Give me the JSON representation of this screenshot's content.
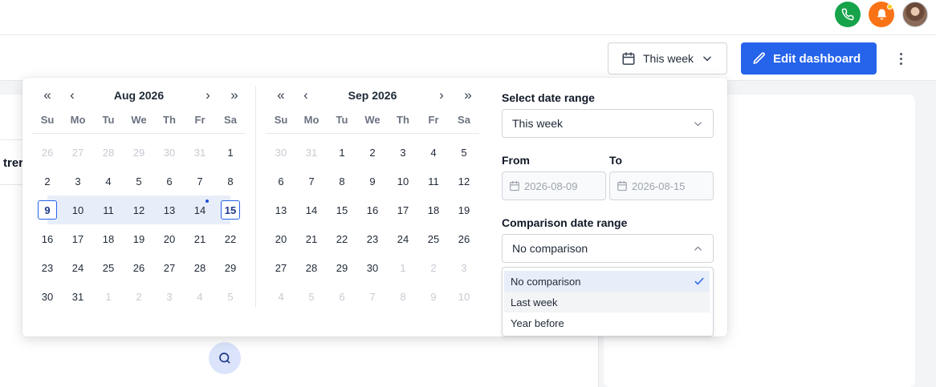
{
  "header": {
    "icons": [
      "phone-icon",
      "bell-icon",
      "avatar"
    ],
    "colors": {
      "phone": "#16a34a",
      "bell": "#f97316",
      "accent": "#2563eb"
    }
  },
  "toolbar": {
    "date_filter_label": "This week",
    "edit_label": "Edit dashboard"
  },
  "background": {
    "partial_heading": "trer"
  },
  "picker": {
    "months": [
      {
        "title": "Aug 2026",
        "weekdays": [
          "Su",
          "Mo",
          "Tu",
          "We",
          "Th",
          "Fr",
          "Sa"
        ],
        "days": [
          {
            "d": "26",
            "muted": true
          },
          {
            "d": "27",
            "muted": true
          },
          {
            "d": "28",
            "muted": true
          },
          {
            "d": "29",
            "muted": true
          },
          {
            "d": "30",
            "muted": true
          },
          {
            "d": "31",
            "muted": true
          },
          {
            "d": "1"
          },
          {
            "d": "2"
          },
          {
            "d": "3"
          },
          {
            "d": "4"
          },
          {
            "d": "5"
          },
          {
            "d": "6"
          },
          {
            "d": "7"
          },
          {
            "d": "8"
          },
          {
            "d": "9",
            "state": "start"
          },
          {
            "d": "10",
            "state": "range"
          },
          {
            "d": "11",
            "state": "range"
          },
          {
            "d": "12",
            "state": "range"
          },
          {
            "d": "13",
            "state": "range"
          },
          {
            "d": "14",
            "state": "range",
            "today": true
          },
          {
            "d": "15",
            "state": "end"
          },
          {
            "d": "16"
          },
          {
            "d": "17"
          },
          {
            "d": "18"
          },
          {
            "d": "19"
          },
          {
            "d": "20"
          },
          {
            "d": "21"
          },
          {
            "d": "22"
          },
          {
            "d": "23"
          },
          {
            "d": "24"
          },
          {
            "d": "25"
          },
          {
            "d": "26"
          },
          {
            "d": "27"
          },
          {
            "d": "28"
          },
          {
            "d": "29"
          },
          {
            "d": "30"
          },
          {
            "d": "31"
          },
          {
            "d": "1",
            "muted": true
          },
          {
            "d": "2",
            "muted": true
          },
          {
            "d": "3",
            "muted": true
          },
          {
            "d": "4",
            "muted": true
          },
          {
            "d": "5",
            "muted": true
          }
        ]
      },
      {
        "title": "Sep 2026",
        "weekdays": [
          "Su",
          "Mo",
          "Tu",
          "We",
          "Th",
          "Fr",
          "Sa"
        ],
        "days": [
          {
            "d": "30",
            "muted": true
          },
          {
            "d": "31",
            "muted": true
          },
          {
            "d": "1"
          },
          {
            "d": "2"
          },
          {
            "d": "3"
          },
          {
            "d": "4"
          },
          {
            "d": "5"
          },
          {
            "d": "6"
          },
          {
            "d": "7"
          },
          {
            "d": "8"
          },
          {
            "d": "9"
          },
          {
            "d": "10"
          },
          {
            "d": "11"
          },
          {
            "d": "12"
          },
          {
            "d": "13"
          },
          {
            "d": "14"
          },
          {
            "d": "15"
          },
          {
            "d": "16"
          },
          {
            "d": "17"
          },
          {
            "d": "18"
          },
          {
            "d": "19"
          },
          {
            "d": "20"
          },
          {
            "d": "21"
          },
          {
            "d": "22"
          },
          {
            "d": "23"
          },
          {
            "d": "24"
          },
          {
            "d": "25"
          },
          {
            "d": "26"
          },
          {
            "d": "27"
          },
          {
            "d": "28"
          },
          {
            "d": "29"
          },
          {
            "d": "30"
          },
          {
            "d": "1",
            "muted": true
          },
          {
            "d": "2",
            "muted": true
          },
          {
            "d": "3",
            "muted": true
          },
          {
            "d": "4",
            "muted": true
          },
          {
            "d": "5",
            "muted": true
          },
          {
            "d": "6",
            "muted": true
          },
          {
            "d": "7",
            "muted": true
          },
          {
            "d": "8",
            "muted": true
          },
          {
            "d": "9",
            "muted": true
          },
          {
            "d": "10",
            "muted": true
          }
        ]
      }
    ],
    "select_range_label": "Select date range",
    "range_value": "This week",
    "from_label": "From",
    "to_label": "To",
    "from_value": "2026-08-09",
    "to_value": "2026-08-15",
    "comparison_label": "Comparison date range",
    "comparison_value": "No comparison",
    "comparison_options": [
      {
        "label": "No comparison",
        "selected": true
      },
      {
        "label": "Last week"
      },
      {
        "label": "Year before"
      }
    ]
  }
}
